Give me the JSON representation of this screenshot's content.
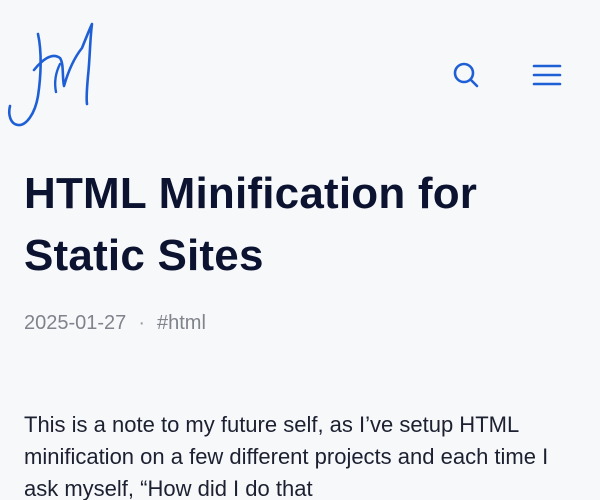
{
  "colors": {
    "background": "#f7f8fa",
    "accent": "#1f5fd6",
    "title": "#0b1330",
    "meta": "#80838c",
    "body": "#1c2030"
  },
  "header": {
    "logo_icon": "signature-logo-icon",
    "search_icon": "search-icon",
    "menu_icon": "hamburger-menu-icon"
  },
  "article": {
    "title": "HTML Minification for Static Sites",
    "date": "2025-01-27",
    "separator": "·",
    "tag": "#html",
    "intro": "This is a note to my future self, as I’ve setup HTML minification on a few different projects and each time I ask myself, “How did I do that"
  }
}
